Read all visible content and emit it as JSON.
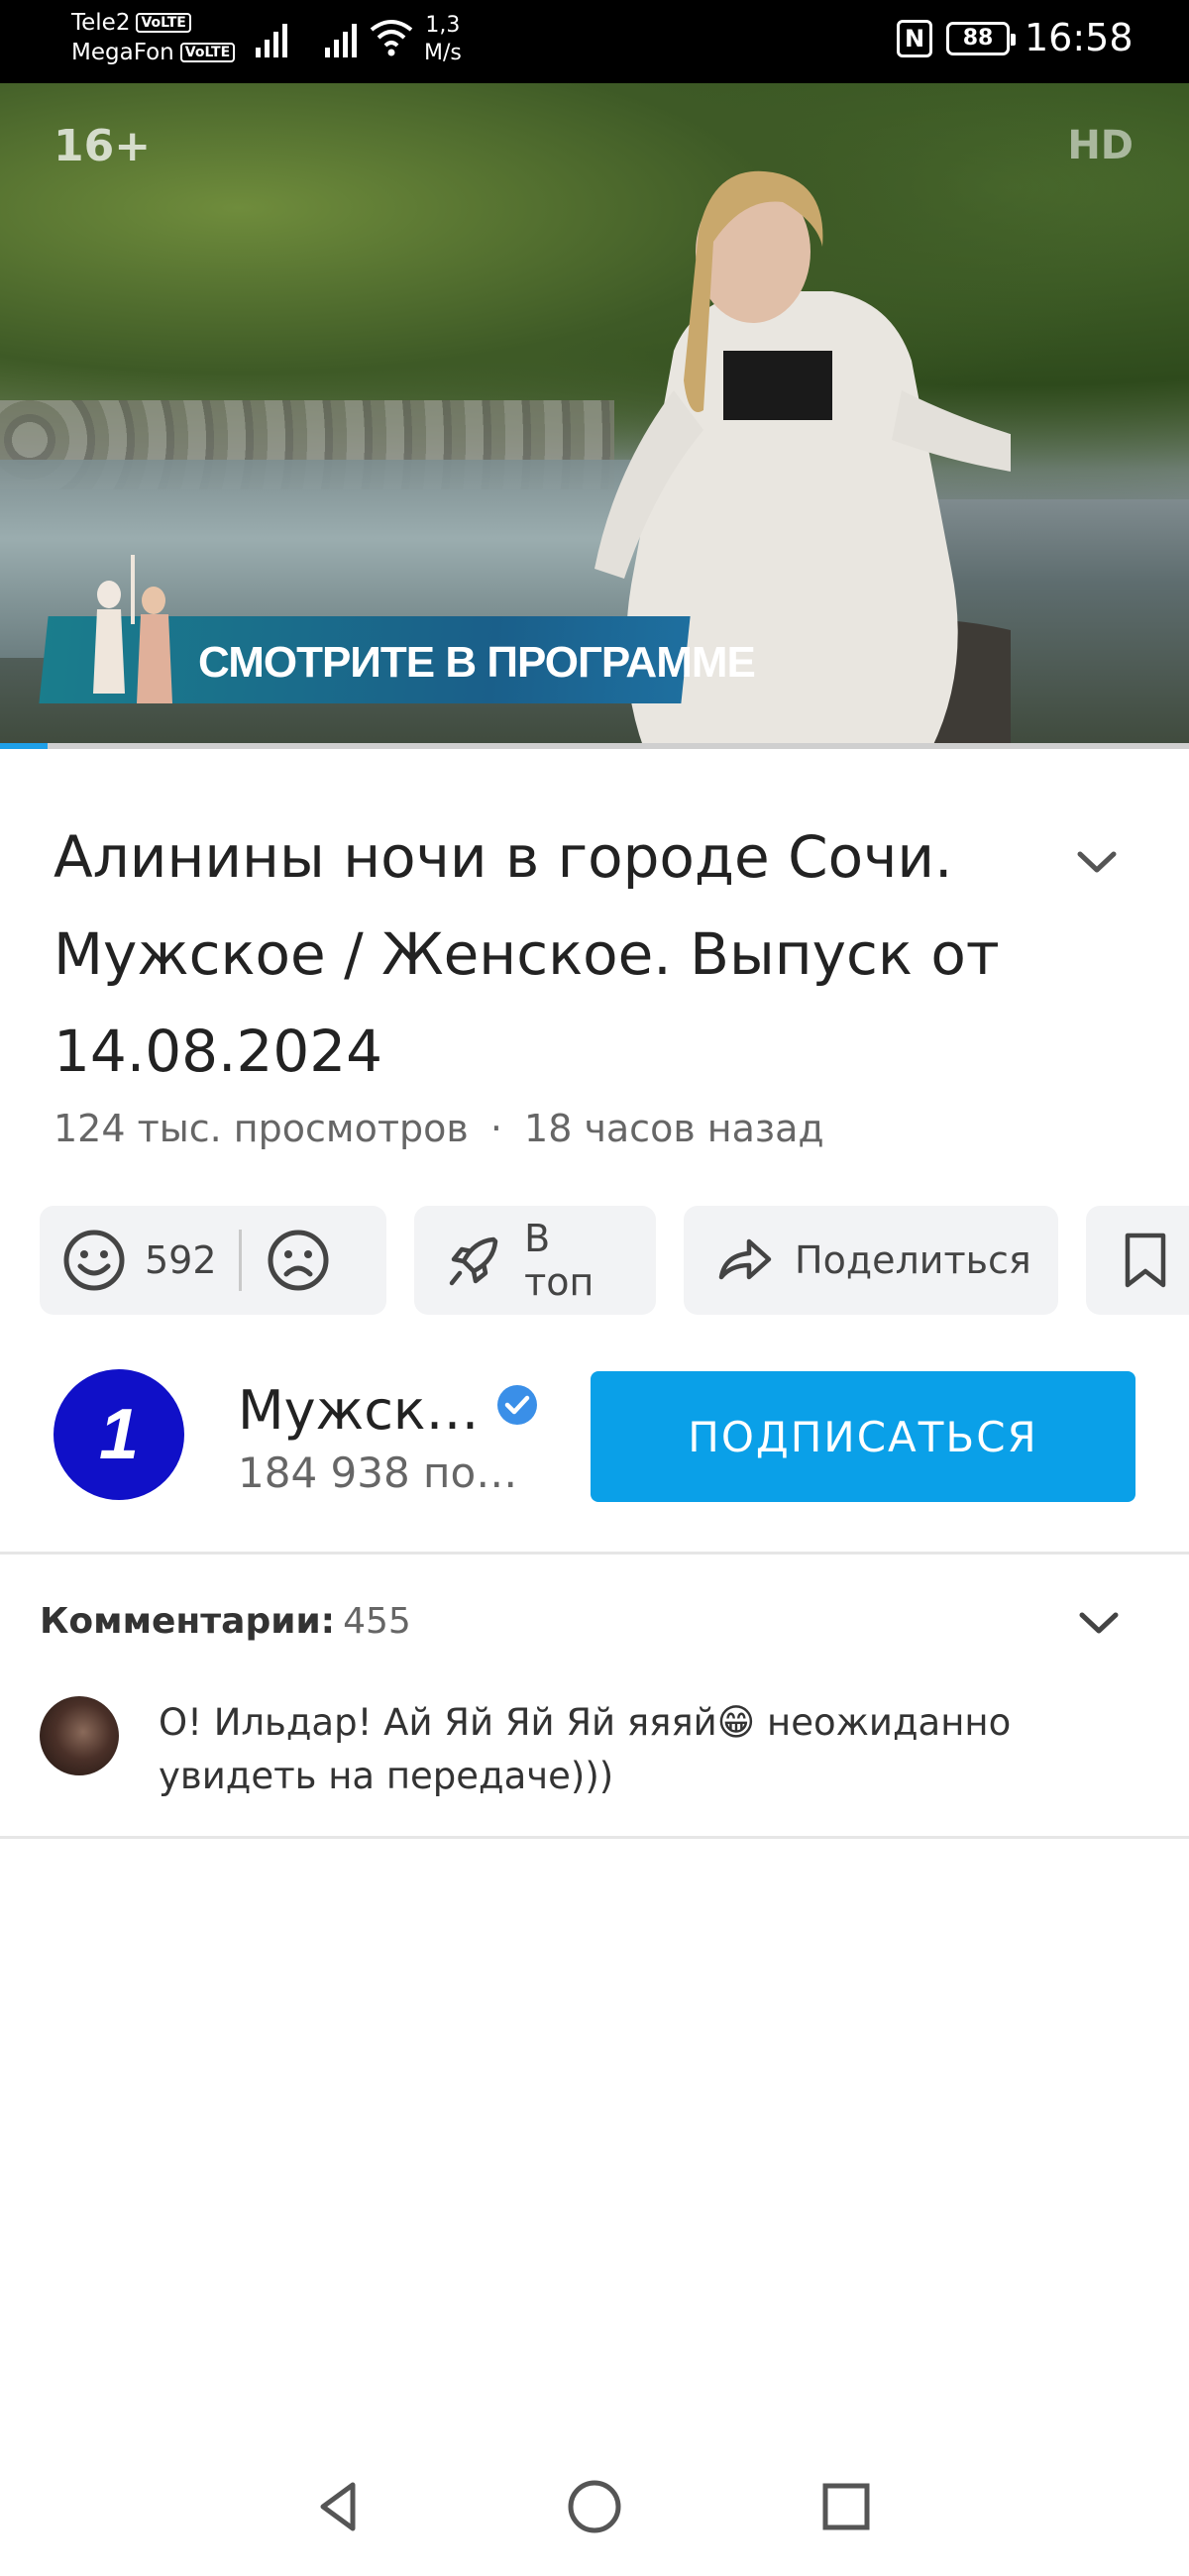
{
  "status_bar": {
    "carrier1": "Tele2",
    "carrier2": "MegaFon",
    "volte": "VoLTE",
    "speed_value": "1,3",
    "speed_unit": "M/s",
    "nfc": "N",
    "battery": "88",
    "time": "16:58"
  },
  "video": {
    "rating": "16+",
    "hd_mark": "HD",
    "banner_text": "СМОТРИТЕ В ПРОГРАММЕ",
    "progress_fraction": 0.003
  },
  "title": "Алинины ночи в городе Сочи. Мужское / Женское. Выпуск от 14.08.2024",
  "meta": {
    "views": "124 тыс. просмотров",
    "separator": "·",
    "age": "18 часов назад"
  },
  "actions": {
    "likes": "592",
    "top_label": "В топ",
    "share_label": "Поделиться"
  },
  "channel": {
    "name": "Мужск…",
    "subscribers": "184 938 по…",
    "subscribe_label": "ПОДПИСАТЬСЯ",
    "logo_glyph": "1"
  },
  "comments": {
    "label": "Комментарии:",
    "count": "455",
    "first": {
      "text": "О! Ильдар! Ай Яй Яй Яй яяяй😁 неожиданно увидеть на передаче)))"
    }
  },
  "icons": {
    "like": "smile-icon",
    "dislike": "sad-icon",
    "top": "rocket-icon",
    "share": "share-arrow-icon",
    "save": "bookmark-icon"
  },
  "colors": {
    "accent": "#0aa0e8",
    "channel_logo": "#1010c8",
    "pill_bg": "#f2f3f5"
  }
}
